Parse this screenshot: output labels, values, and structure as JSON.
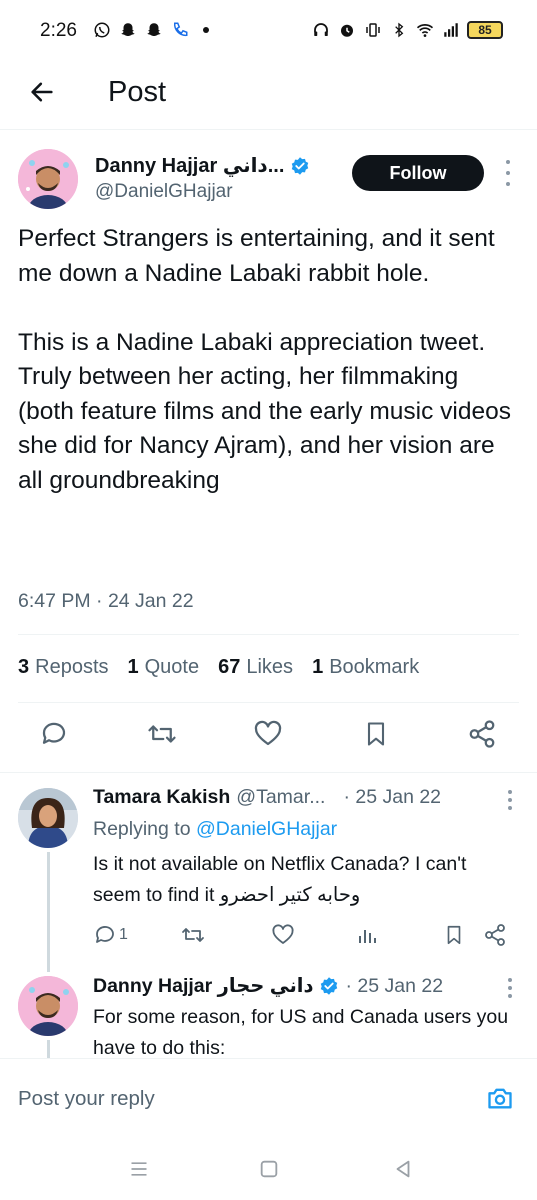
{
  "status_bar": {
    "time": "2:26",
    "left_icons": [
      "whatsapp-icon",
      "snapchat-icon",
      "snapchat-icon",
      "phone-icon",
      "dot-icon"
    ],
    "right_icons": [
      "headphones-icon",
      "alarm-icon",
      "vibrate-icon",
      "bluetooth-icon",
      "wifi-icon",
      "signal-icon"
    ],
    "battery": "85"
  },
  "header": {
    "title": "Post"
  },
  "post": {
    "author_name": "Danny Hajjar داني...",
    "author_handle": "@DanielGHajjar",
    "follow_label": "Follow",
    "paragraph1": "Perfect Strangers is entertaining, and it sent me down a Nadine Labaki rabbit hole.",
    "paragraph2": "This is a Nadine Labaki appreciation tweet. Truly between her acting, her filmmaking (both feature films and the early music videos she did for Nancy Ajram), and her vision are all groundbreaking",
    "timestamp": "6:47 PM · 24 Jan 22",
    "stats": {
      "reposts_count": "3",
      "reposts_label": "Reposts",
      "quotes_count": "1",
      "quotes_label": "Quote",
      "likes_count": "67",
      "likes_label": "Likes",
      "bookmarks_count": "1",
      "bookmarks_label": "Bookmark"
    }
  },
  "replies": [
    {
      "name": "Tamara Kakish",
      "handle": "@Tamar...",
      "date": "· 25 Jan 22",
      "replying_prefix": "Replying to",
      "replying_handle": "@DanielGHajjar",
      "text": "Is it not available on Netflix Canada? I can't seem to find it وحابه كتير احضرو",
      "reply_count": "1"
    },
    {
      "name": "Danny Hajjar داني حجار",
      "date": "· 25 Jan 22",
      "text": "For some reason, for US and Canada users you have to do this:"
    }
  ],
  "reply_bar": {
    "placeholder": "Post your reply"
  },
  "colors": {
    "accent": "#1d9bf0",
    "text": "#0f1419",
    "secondary": "#536471",
    "follow_bg": "#0f1419"
  }
}
